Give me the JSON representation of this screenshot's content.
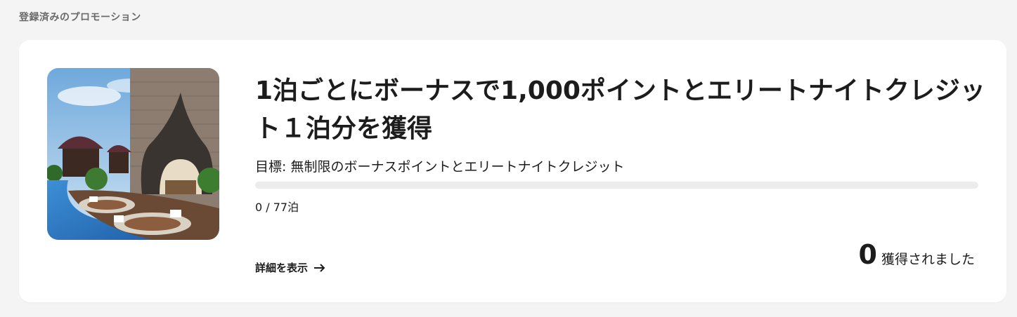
{
  "section": {
    "title": "登録済みのプロモーション"
  },
  "promotion": {
    "headline": "1泊ごとにボーナスで1,000ポイントとエリートナイトクレジット１泊分を獲得",
    "goal": "目標: 無制限のボーナスポイントとエリートナイトクレジット",
    "progress_fraction": 0,
    "progress_text": "0 / 77泊",
    "details_label": "詳細を表示",
    "earned_count": "0",
    "earned_label": "獲得されました",
    "image_subject": "resort-pool-photo"
  },
  "icons": {
    "details_arrow": "arrow-right-icon"
  },
  "colors": {
    "background": "#f4f4f4",
    "card": "#ffffff",
    "text": "#1c1c1c",
    "muted": "#6a6a6a",
    "track": "#ececec"
  }
}
